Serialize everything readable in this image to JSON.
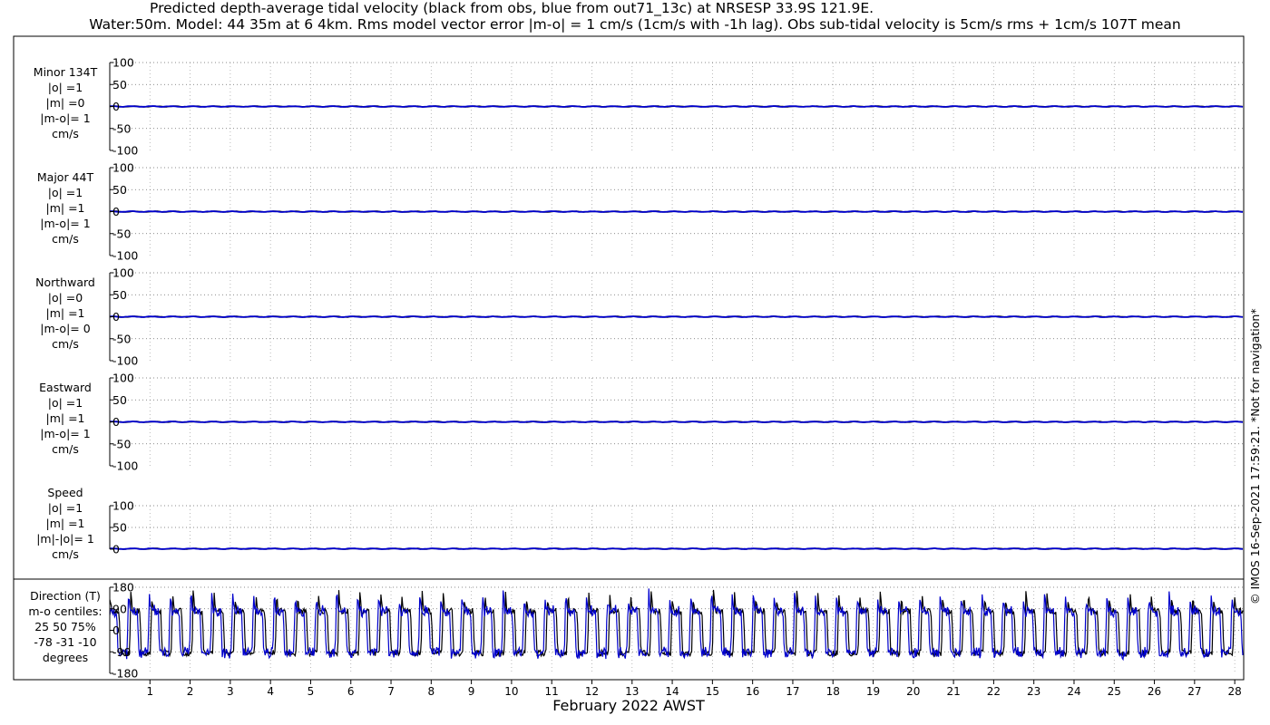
{
  "header": {
    "title_line1": "Predicted depth-average tidal velocity (black from obs, blue from out71_13c) at NRSESP 33.9S 121.9E.",
    "title_line2": "Water:50m. Model: 44 35m at 6 4km. Rms model vector error |m-o| = 1 cm/s (1cm/s with -1h lag). Obs sub-tidal velocity is 5cm/s rms + 1cm/s 107T mean"
  },
  "copyright": "© IMOS 16-Sep-2021 17:59:21. *Not for navigation*",
  "colors": {
    "obs": "#000000",
    "model": "#0000cc",
    "grid": "#888888"
  },
  "chart_data": {
    "type": "line",
    "xlabel": "February 2022 AWST",
    "x_ticks": [
      "1",
      "2",
      "3",
      "4",
      "5",
      "6",
      "7",
      "8",
      "9",
      "10",
      "11",
      "12",
      "13",
      "14",
      "15",
      "16",
      "17",
      "18",
      "19",
      "20",
      "21",
      "22",
      "23",
      "24",
      "25",
      "26",
      "27",
      "28"
    ],
    "xlim": [
      0.0,
      28.2
    ],
    "series": [
      {
        "name": "obs",
        "color": "#000000"
      },
      {
        "name": "out71_13c",
        "color": "#0000cc"
      }
    ],
    "panels": [
      {
        "id": "minor",
        "label_lines": [
          "Minor 134T",
          "|o| =1",
          "|m| =0",
          "|m-o|= 1",
          "cm/s"
        ],
        "ylim": [
          -100,
          100
        ],
        "y_ticks": [
          "100",
          "50",
          "0",
          "-50",
          "-100"
        ],
        "obs_value": 0,
        "model_value": 0
      },
      {
        "id": "major",
        "label_lines": [
          "Major 44T",
          "|o| =1",
          "|m| =1",
          "|m-o|= 1",
          "cm/s"
        ],
        "ylim": [
          -100,
          100
        ],
        "y_ticks": [
          "100",
          "50",
          "0",
          "-50",
          "-100"
        ],
        "obs_value": 0,
        "model_value": 0
      },
      {
        "id": "northward",
        "label_lines": [
          "Northward",
          "|o| =0",
          "|m| =1",
          "|m-o|= 0",
          "cm/s"
        ],
        "ylim": [
          -100,
          100
        ],
        "y_ticks": [
          "100",
          "50",
          "0",
          "-50",
          "-100"
        ],
        "obs_value": 0,
        "model_value": 0
      },
      {
        "id": "eastward",
        "label_lines": [
          "Eastward",
          "|o| =1",
          "|m| =1",
          "|m-o|= 1",
          "cm/s"
        ],
        "ylim": [
          -100,
          100
        ],
        "y_ticks": [
          "100",
          "50",
          "0",
          "-50",
          "-100"
        ],
        "obs_value": 0,
        "model_value": 0
      },
      {
        "id": "speed",
        "label_lines": [
          "Speed",
          "|o| =1",
          "|m| =1",
          "|m|-|o|= 1",
          "cm/s"
        ],
        "ylim": [
          0,
          100
        ],
        "y_ticks": [
          "100",
          "50",
          "0"
        ],
        "obs_value": 1,
        "model_value": 1
      },
      {
        "id": "direction",
        "label_lines": [
          "Direction (T)",
          "m-o centiles:",
          "25  50  75%",
          "-78 -31 -10",
          "degrees"
        ],
        "ylim": [
          -180,
          180
        ],
        "y_ticks": [
          "180",
          "90",
          "0",
          "-90",
          "-180"
        ],
        "note": "Direction is a noisy square-wave signal swinging roughly between -100 and +100 degrees about twice per day; obs (black) and model (blue) closely overlap with a lag."
      }
    ]
  }
}
